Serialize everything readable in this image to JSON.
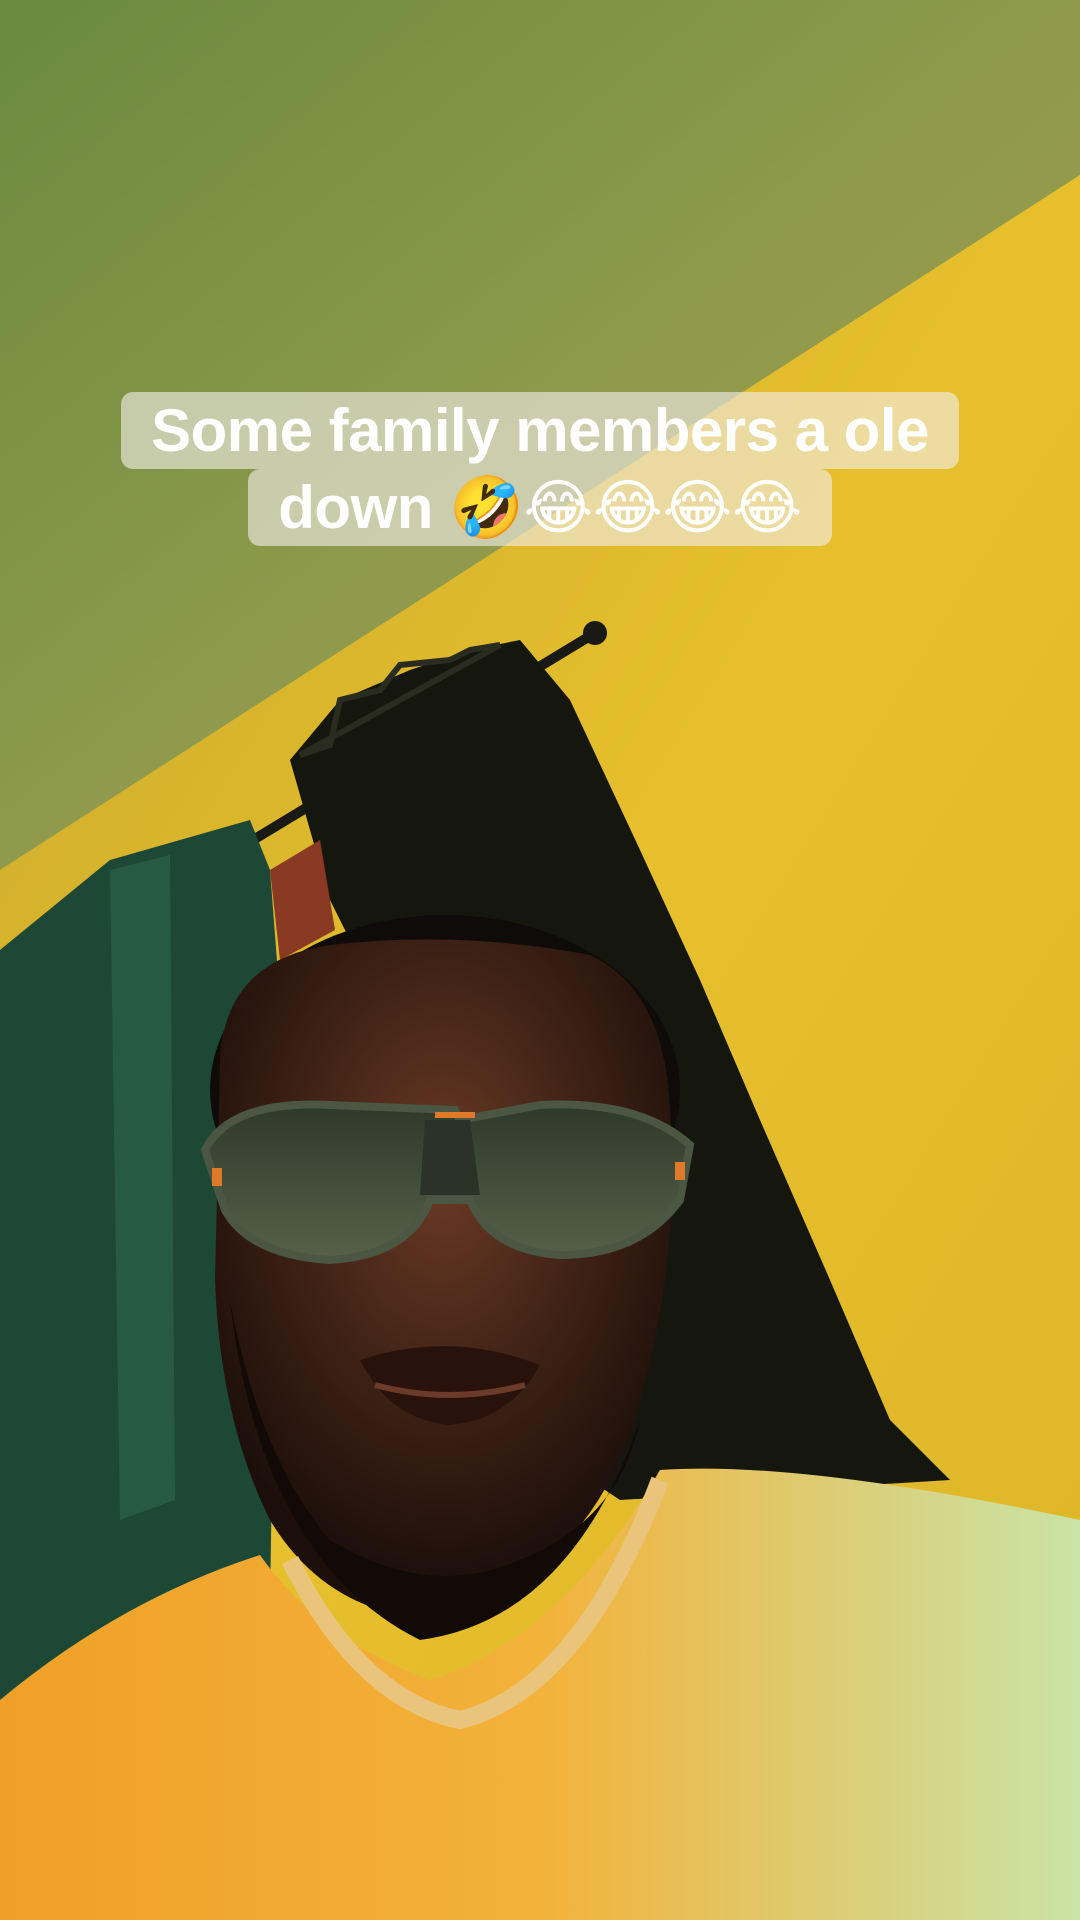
{
  "caption": {
    "line1": "Some family members a ole",
    "line2": "down 🤣😂😂😂😂"
  },
  "colors": {
    "ceiling": "#7d8f45",
    "wall": "#e3bb2a",
    "curtain_dark": "#141810",
    "curtain_green": "#1e4a36",
    "shirt": "#f3a82a",
    "skin": "#3b2116"
  }
}
